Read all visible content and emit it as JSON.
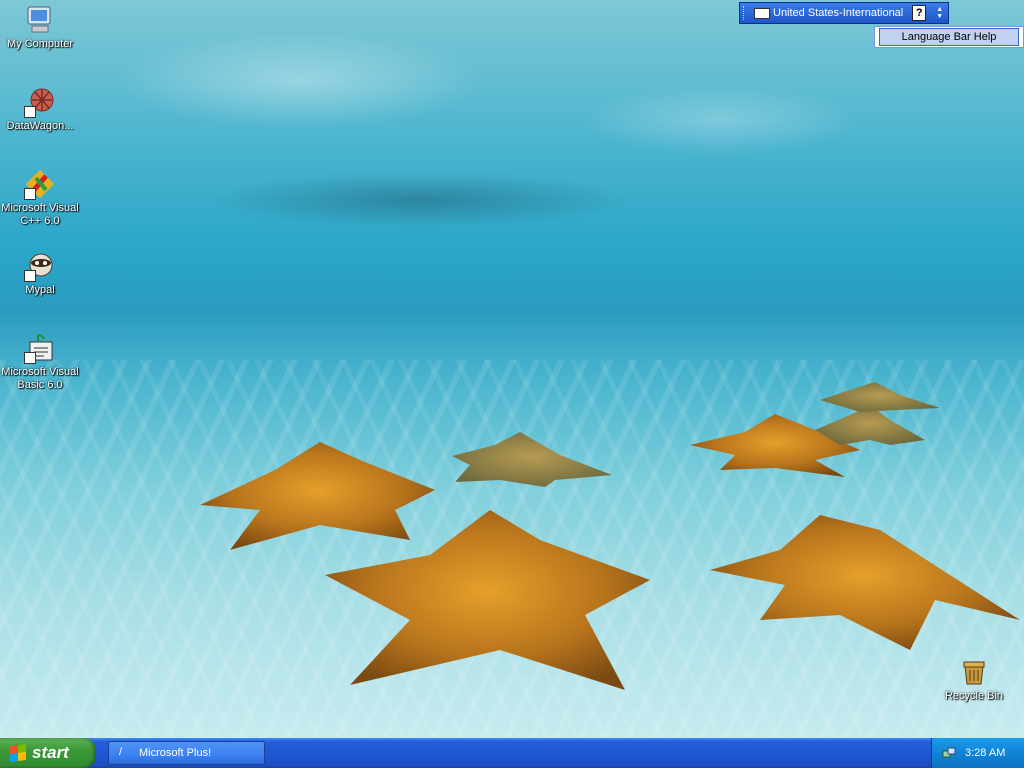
{
  "desktop": {
    "icons": [
      {
        "label": "My Computer",
        "icon": "my-computer-icon"
      },
      {
        "label": "DataWagon...",
        "icon": "datawagon-icon"
      },
      {
        "label": "Microsoft Visual C++ 6.0",
        "icon": "visual-cpp-icon"
      },
      {
        "label": "Mypal",
        "icon": "mypal-icon"
      },
      {
        "label": "Microsoft Visual Basic 6.0",
        "icon": "visual-basic-icon"
      },
      {
        "label": "Recycle Bin",
        "icon": "recycle-bin-icon"
      }
    ]
  },
  "language_bar": {
    "language": "United States-International",
    "help_glyph": "?",
    "menu_item": "Language Bar Help"
  },
  "taskbar": {
    "start_label": "start",
    "task_label": "Microsoft Plus!",
    "clock": "3:28 AM"
  }
}
